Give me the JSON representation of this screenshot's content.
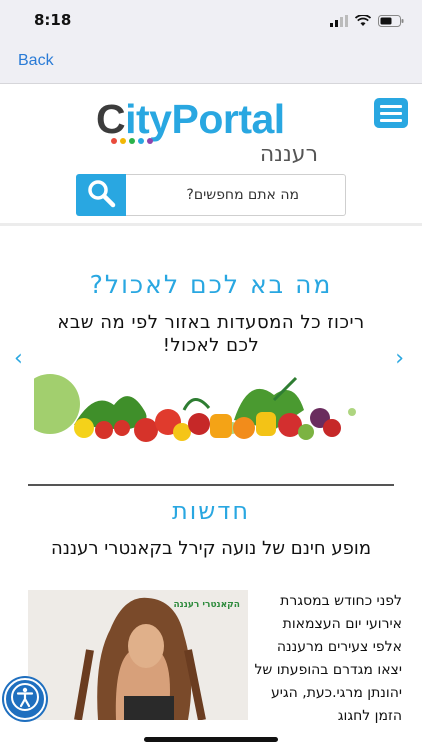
{
  "status_bar": {
    "time": "8:18"
  },
  "nav": {
    "back_label": "Back"
  },
  "logo": {
    "part1": "C",
    "part2": "ity",
    "part3": "Portal",
    "city": "רעננה"
  },
  "search": {
    "placeholder": "מה אתם מחפשים?"
  },
  "food": {
    "title": "מה בא לכם לאכול?",
    "subtitle": "ריכוז כל המסעדות באזור לפי מה שבא לכם לאכול!",
    "prev": "‹",
    "next": "›"
  },
  "news": {
    "title": "חדשות",
    "headline": "מופע חינם של נועה קירל בקאנטרי רעננה",
    "body": "לפני כחודש במסגרת אירועי יום העצמאות אלפי צעירים מרעננה יצאו מגדרם בהופעתו של יהונתן מרגי.כעת, הגיע הזמן לחגוג",
    "image_logo": "הקאנטרי רעננה"
  },
  "colors": {
    "brand_blue": "#29a7e1",
    "ios_link": "#2a7bd6"
  }
}
